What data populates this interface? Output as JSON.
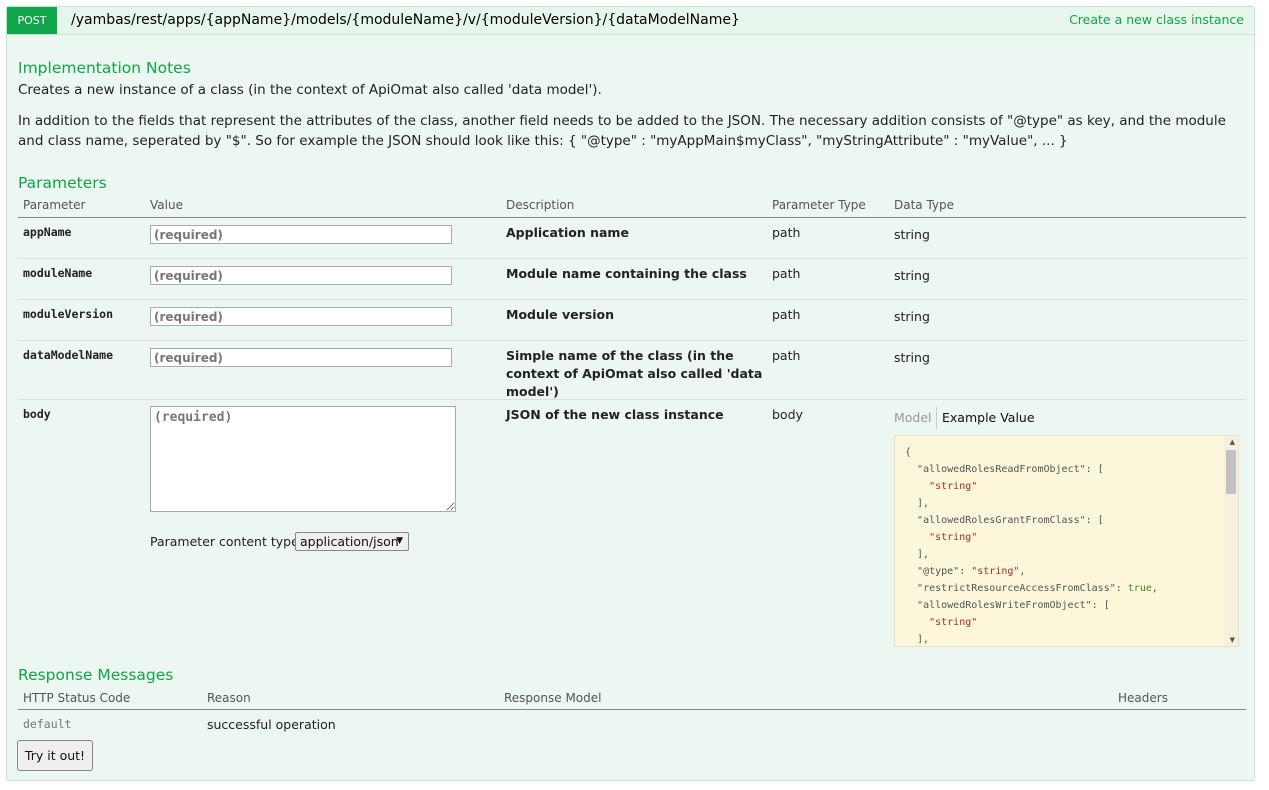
{
  "operation": {
    "method": "POST",
    "path": "/yambas/rest/apps/{appName}/models/{moduleName}/v/{moduleVersion}/{dataModelName}",
    "summary": "Create a new class instance"
  },
  "implementation": {
    "heading": "Implementation Notes",
    "paragraph1": "Creates a new instance of a class (in the context of ApiOmat also called 'data model').",
    "paragraph2": "In addition to the fields that represent the attributes of the class, another field needs to be added to the JSON. The necessary addition consists of \"@type\" as key, and the module and class name, seperated by \"$\". So for example the JSON should look like this: { \"@type\" : \"myAppMain$myClass\", \"myStringAttribute\" : \"myValue\", ... }"
  },
  "parameters": {
    "heading": "Parameters",
    "columns": [
      "Parameter",
      "Value",
      "Description",
      "Parameter Type",
      "Data Type"
    ],
    "rows": [
      {
        "name": "appName",
        "placeholder": "(required)",
        "description": "Application name",
        "param_type": "path",
        "data_type": "string"
      },
      {
        "name": "moduleName",
        "placeholder": "(required)",
        "description": "Module name containing the class",
        "param_type": "path",
        "data_type": "string"
      },
      {
        "name": "moduleVersion",
        "placeholder": "(required)",
        "description": "Module version",
        "param_type": "path",
        "data_type": "string"
      },
      {
        "name": "dataModelName",
        "placeholder": "(required)",
        "description": "Simple name of the class (in the context of ApiOmat also called 'data model')",
        "param_type": "path",
        "data_type": "string"
      },
      {
        "name": "body",
        "placeholder": "(required)",
        "description": "JSON of the new class instance",
        "param_type": "body",
        "data_type": ""
      }
    ],
    "content_type_label": "Parameter content type:",
    "content_type_value": "application/json",
    "tab_model": "Model",
    "tab_example": "Example Value",
    "example_value": "{\n  \"allowedRolesReadFromObject\": [\n    \"string\"\n  ],\n  \"allowedRolesGrantFromClass\": [\n    \"string\"\n  ],\n  \"@type\": \"string\",\n  \"restrictResourceAccessFromClass\": true,\n  \"allowedRolesWriteFromObject\": [\n    \"string\"\n  ],"
  },
  "responses": {
    "heading": "Response Messages",
    "columns": [
      "HTTP Status Code",
      "Reason",
      "Response Model",
      "Headers"
    ],
    "rows": [
      {
        "code": "default",
        "reason": "successful operation"
      }
    ]
  },
  "try_button": "Try it out!"
}
